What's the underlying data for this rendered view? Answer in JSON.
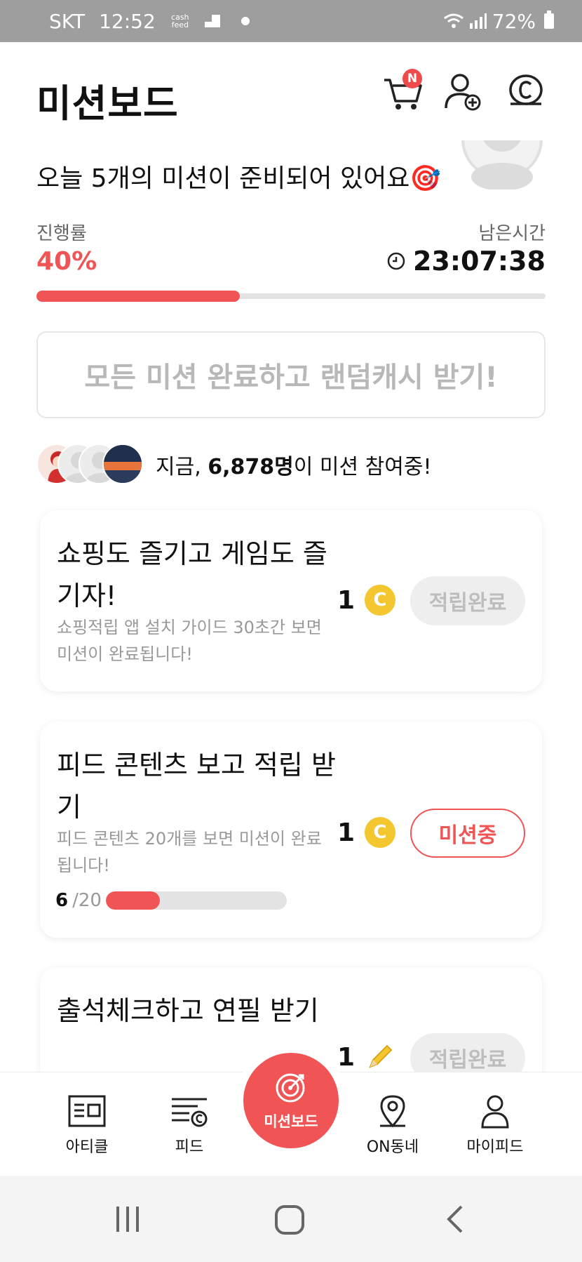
{
  "status_bar": {
    "carrier": "SKT",
    "time": "12:52",
    "cashfeed_badge": "cash feed",
    "battery": "72%"
  },
  "header": {
    "title": "미션보드",
    "cart_badge": "N",
    "icons": [
      "cart-icon",
      "add-friend-icon",
      "coin-icon"
    ]
  },
  "greeting": "오늘 5개의 미션이 준비되어 있어요🎯",
  "progress": {
    "label": "진행률",
    "value": "40%",
    "fraction": 0.4,
    "remaining_label": "남은시간",
    "remaining_time": "23:07:38"
  },
  "reward_box": "모든 미션 완료하고 랜덤캐시 받기!",
  "participants": {
    "prefix": "지금, ",
    "count": "6,878명",
    "suffix": "이 미션 참여중!"
  },
  "missions": [
    {
      "title": "쇼핑도 즐기고 게임도 즐기자!",
      "desc": "쇼핑적립 앱 설치 가이드 30초간 보면 미션이 완료됩니다!",
      "reward": "1",
      "reward_icon": "coin-icon",
      "button": "적립완료",
      "state": "done"
    },
    {
      "title": "피드 콘텐츠 보고 적립 받기",
      "desc": "피드 콘텐츠 20개를 보면 미션이 완료됩니다!",
      "reward": "1",
      "reward_icon": "coin-icon",
      "button": "미션중",
      "state": "active",
      "progress_current": "6",
      "progress_total": "/20",
      "progress_fraction": 0.3
    },
    {
      "title": "출석체크하고 연필 받기",
      "desc": "",
      "reward": "1",
      "reward_icon": "pencil-icon",
      "button": "적립완료",
      "state": "done"
    }
  ],
  "bottom_nav": {
    "article": "아티클",
    "feed": "피드",
    "missionboard": "미션보드",
    "on_town": "ON동네",
    "myfeed": "마이피드"
  },
  "colors": {
    "accent": "#f05454",
    "coin": "#f4c630",
    "statusbar": "#9e9e9e"
  }
}
